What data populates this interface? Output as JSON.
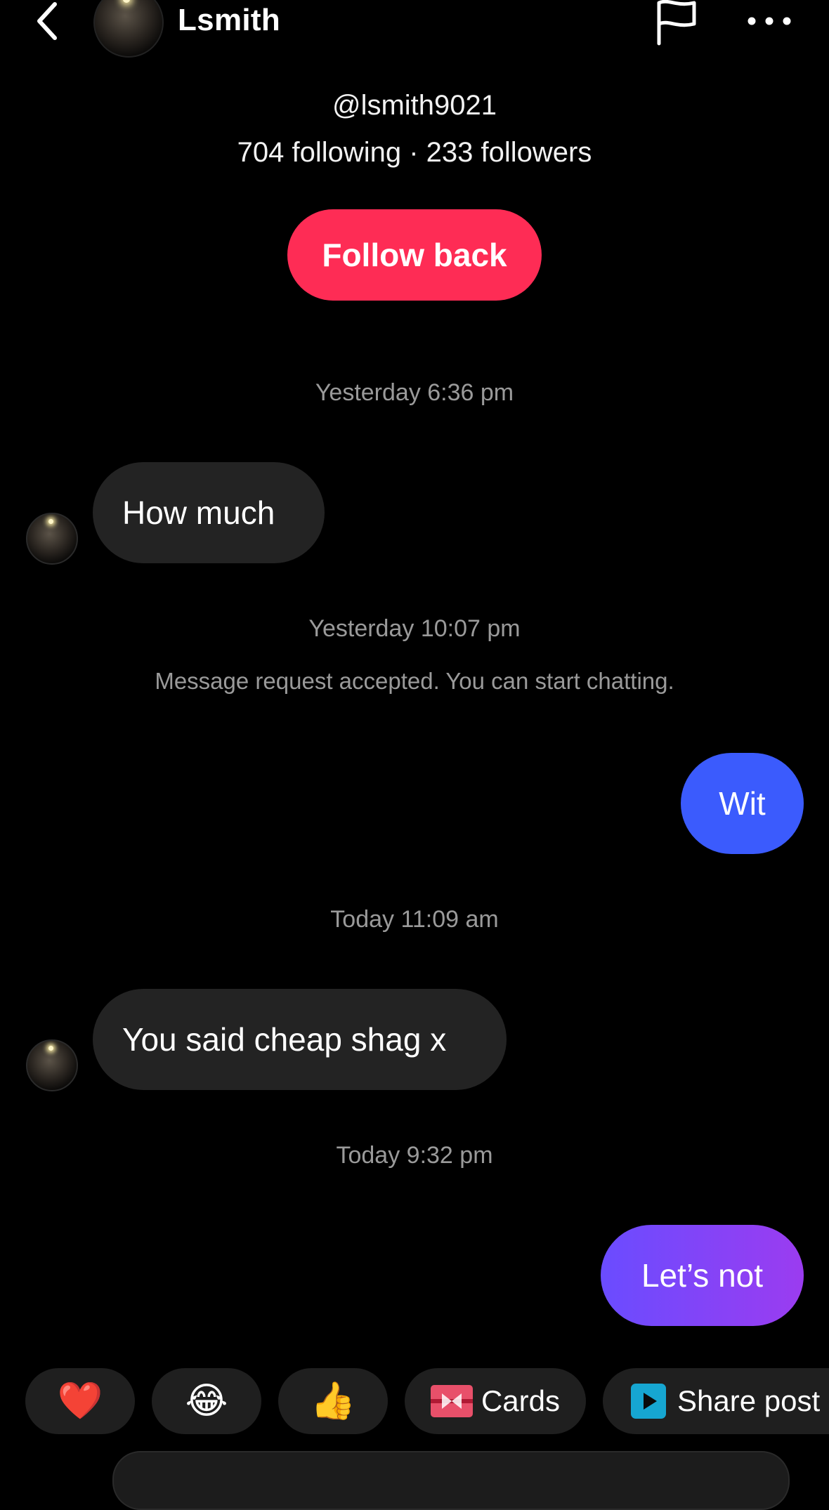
{
  "header": {
    "name": "Lsmith",
    "back_icon": "chevron-left-icon",
    "report_icon": "flag-icon",
    "more_icon": "more-horizontal-icon"
  },
  "profile": {
    "handle": "@lsmith9021",
    "stats": "704 following · 233 followers",
    "follow_button": "Follow back"
  },
  "colors": {
    "follow": "#fe2c55",
    "outgoing_blue": "#3b5bfd",
    "outgoing_purple_start": "#6a4cff",
    "outgoing_purple_end": "#9b3cf0",
    "incoming": "#232323"
  },
  "messages": [
    {
      "timestamp": "Yesterday 6:36 pm"
    },
    {
      "from": "them",
      "text": "How much"
    },
    {
      "timestamp": "Yesterday 10:07 pm"
    },
    {
      "system": "Message request accepted. You can start chatting."
    },
    {
      "from": "me",
      "text": "Wit"
    },
    {
      "timestamp": "Today 11:09 am"
    },
    {
      "from": "them",
      "text": "You said cheap shag x"
    },
    {
      "timestamp": "Today 9:32 pm"
    },
    {
      "from": "me",
      "text": "Let’s not"
    }
  ],
  "quick_actions": [
    {
      "icon": "heart-emoji",
      "glyph": "❤️"
    },
    {
      "icon": "laughing-emoji",
      "glyph": "😂"
    },
    {
      "icon": "thumbs-up-emoji",
      "glyph": "👍"
    },
    {
      "icon": "cards-icon",
      "label": "Cards"
    },
    {
      "icon": "share-post-icon",
      "label": "Share post"
    }
  ]
}
